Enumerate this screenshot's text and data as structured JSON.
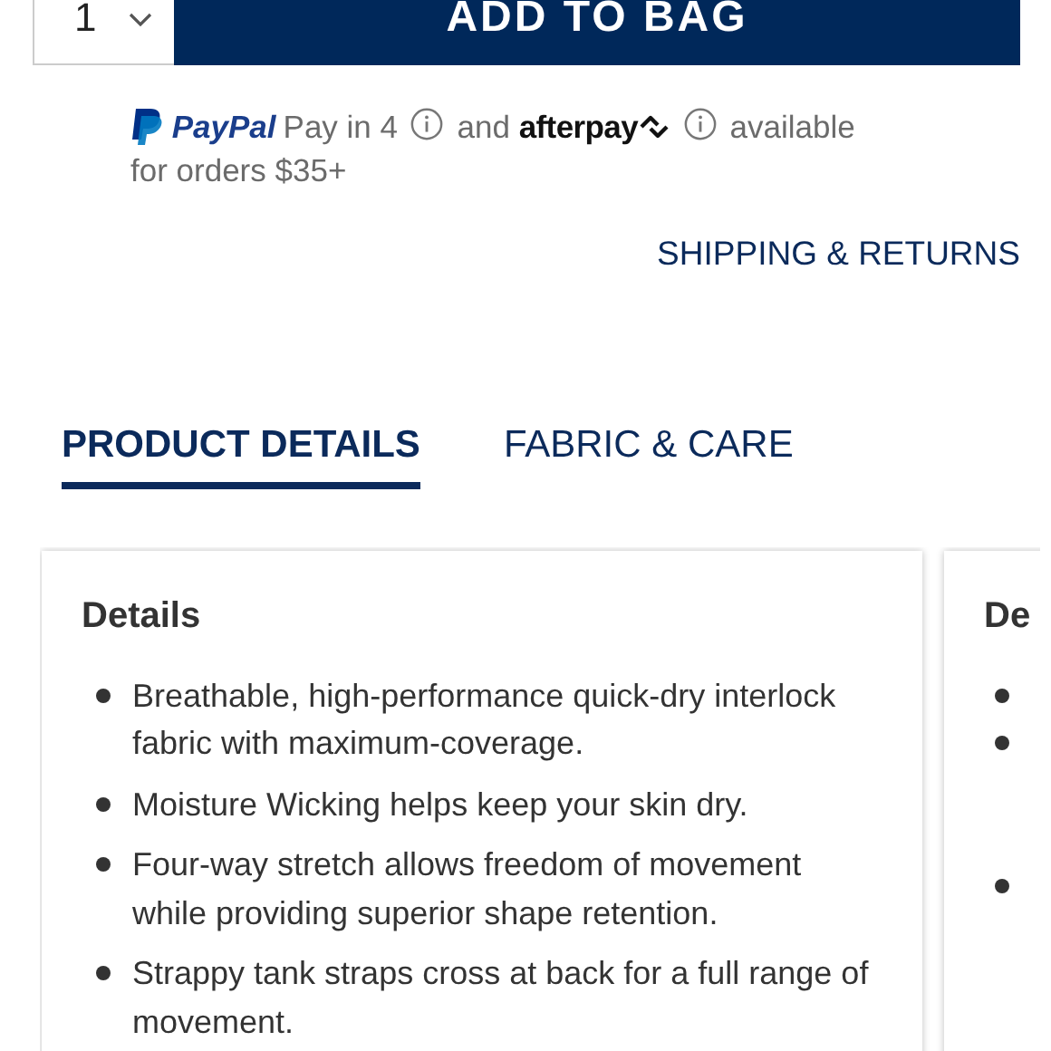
{
  "purchase": {
    "quantity": "1",
    "add_button": "ADD TO BAG"
  },
  "payment_note": {
    "paypal": "PayPal",
    "pay_in": "Pay in 4",
    "and": "and",
    "afterpay": "afterpay",
    "rest": "available",
    "rest2": "for orders $35+"
  },
  "shipping_link": "SHIPPING & RETURNS",
  "tabs": [
    {
      "label": "PRODUCT DETAILS",
      "selected": true
    },
    {
      "label": "FABRIC & CARE",
      "selected": false
    }
  ],
  "cards": [
    {
      "title": "Details",
      "items": [
        "Breathable, high-performance quick-dry interlock fabric with maximum-coverage.",
        "Moisture Wicking helps keep your skin dry.",
        "Four-way stretch allows freedom of movement while providing superior shape retention.",
        "Strappy tank straps cross at back for a full range of movement."
      ]
    },
    {
      "title": "De"
    }
  ]
}
